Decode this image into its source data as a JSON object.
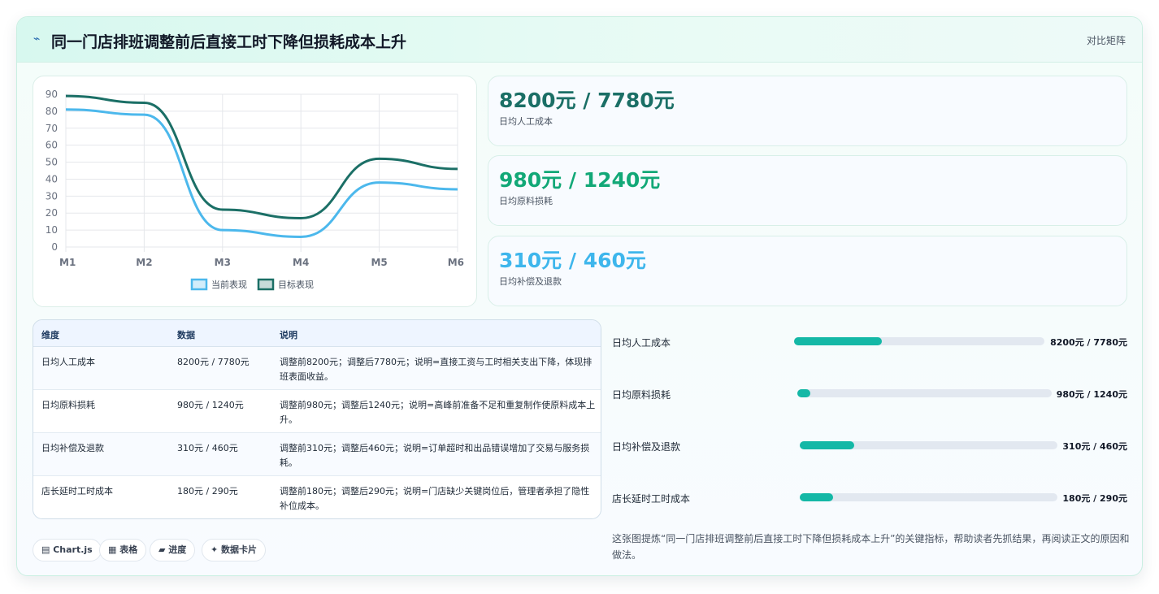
{
  "header": {
    "icon": "⌁",
    "title": "同一门店排班调整前后直接工时下降但损耗成本上升",
    "tag": "对比矩阵"
  },
  "chart_data": {
    "type": "line",
    "categories": [
      "M1",
      "M2",
      "M3",
      "M4",
      "M5",
      "M6"
    ],
    "ylim": [
      0,
      90
    ],
    "yticks": [
      "0",
      "10",
      "20",
      "30",
      "40",
      "50",
      "60",
      "70",
      "80",
      "90"
    ],
    "series": [
      {
        "name": "当前表现",
        "values": [
          81,
          78,
          10,
          6,
          38,
          34
        ],
        "color": "#4cb8ec"
      },
      {
        "name": "目标表现",
        "values": [
          89,
          85,
          22,
          17,
          52,
          46
        ],
        "color": "#1b6f66"
      }
    ],
    "legend_position": "bottom"
  },
  "metrics": [
    {
      "value": "8200元 / 7780元",
      "label": "日均人工成本",
      "color": "#1b6f66"
    },
    {
      "value": "980元 / 1240元",
      "label": "日均原料损耗",
      "color": "#12a877"
    },
    {
      "value": "310元 / 460元",
      "label": "日均补偿及退款",
      "color": "#3eb6ec"
    }
  ],
  "table": {
    "headers": [
      "维度",
      "数据",
      "说明"
    ],
    "rows": [
      {
        "dim": "日均人工成本",
        "data": "8200元 / 7780元",
        "desc": "调整前8200元；调整后7780元；说明=直接工资与工时相关支出下降，体现排班表面收益。"
      },
      {
        "dim": "日均原料损耗",
        "data": "980元 / 1240元",
        "desc": "调整前980元；调整后1240元；说明=高峰前准备不足和重复制作使原料成本上升。"
      },
      {
        "dim": "日均补偿及退款",
        "data": "310元 / 460元",
        "desc": "调整前310元；调整后460元；说明=订单超时和出品错误增加了交易与服务损耗。"
      },
      {
        "dim": "店长延时工时成本",
        "data": "180元 / 290元",
        "desc": "调整前180元；调整后290元；说明=门店缺少关键岗位后，管理者承担了隐性补位成本。"
      }
    ]
  },
  "progress": [
    {
      "label": "日均人工成本",
      "value": "8200元 / 7780元",
      "fill": 0.35
    },
    {
      "label": "日均原料损耗",
      "value": "980元 / 1240元",
      "fill": 0.05
    },
    {
      "label": "日均补偿及退款",
      "value": "310元 / 460元",
      "fill": 0.21
    },
    {
      "label": "店长延时工时成本",
      "value": "180元 / 290元",
      "fill": 0.13
    }
  ],
  "chips": [
    {
      "label": "▤ Chart.js"
    },
    {
      "label": "▦ 表格"
    },
    {
      "label": "▰ 进度"
    },
    {
      "label": "✦ 数据卡片"
    }
  ],
  "note": "这张图提炼“同一门店排班调整前后直接工时下降但损耗成本上升”的关键指标，帮助读者先抓结果，再阅读正文的原因和做法。"
}
